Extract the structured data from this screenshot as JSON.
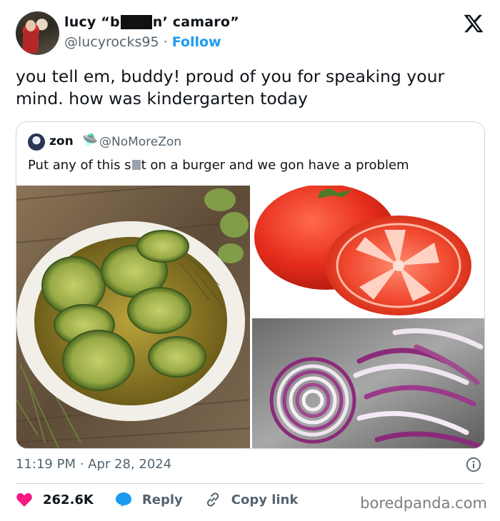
{
  "author": {
    "name_prefix": "lucy “b",
    "name_suffix": "n’ camaro”",
    "handle": "@lucyrocks95",
    "separator": " · ",
    "follow_label": "Follow"
  },
  "tweet": {
    "text": "you tell em, buddy! proud of you for speaking your mind. how was kindergarten today"
  },
  "quoted_tweet": {
    "name": "zon",
    "emoji": "🛸",
    "handle": "@NoMoreZon",
    "text_prefix": "Put any of this s",
    "text_suffix": "t on a burger and we gon have a problem",
    "media": [
      "pickles",
      "tomato",
      "red onion"
    ]
  },
  "meta": {
    "time": "11:19 PM",
    "separator": " · ",
    "date": "Apr 28, 2024"
  },
  "actions": {
    "like_count": "262.6K",
    "reply_label": "Reply",
    "copy_label": "Copy link"
  },
  "watermark": "boredpanda.com",
  "colors": {
    "accent": "#1d9bf0",
    "like": "#f91880",
    "text": "#0f1419",
    "secondary": "#536471"
  }
}
